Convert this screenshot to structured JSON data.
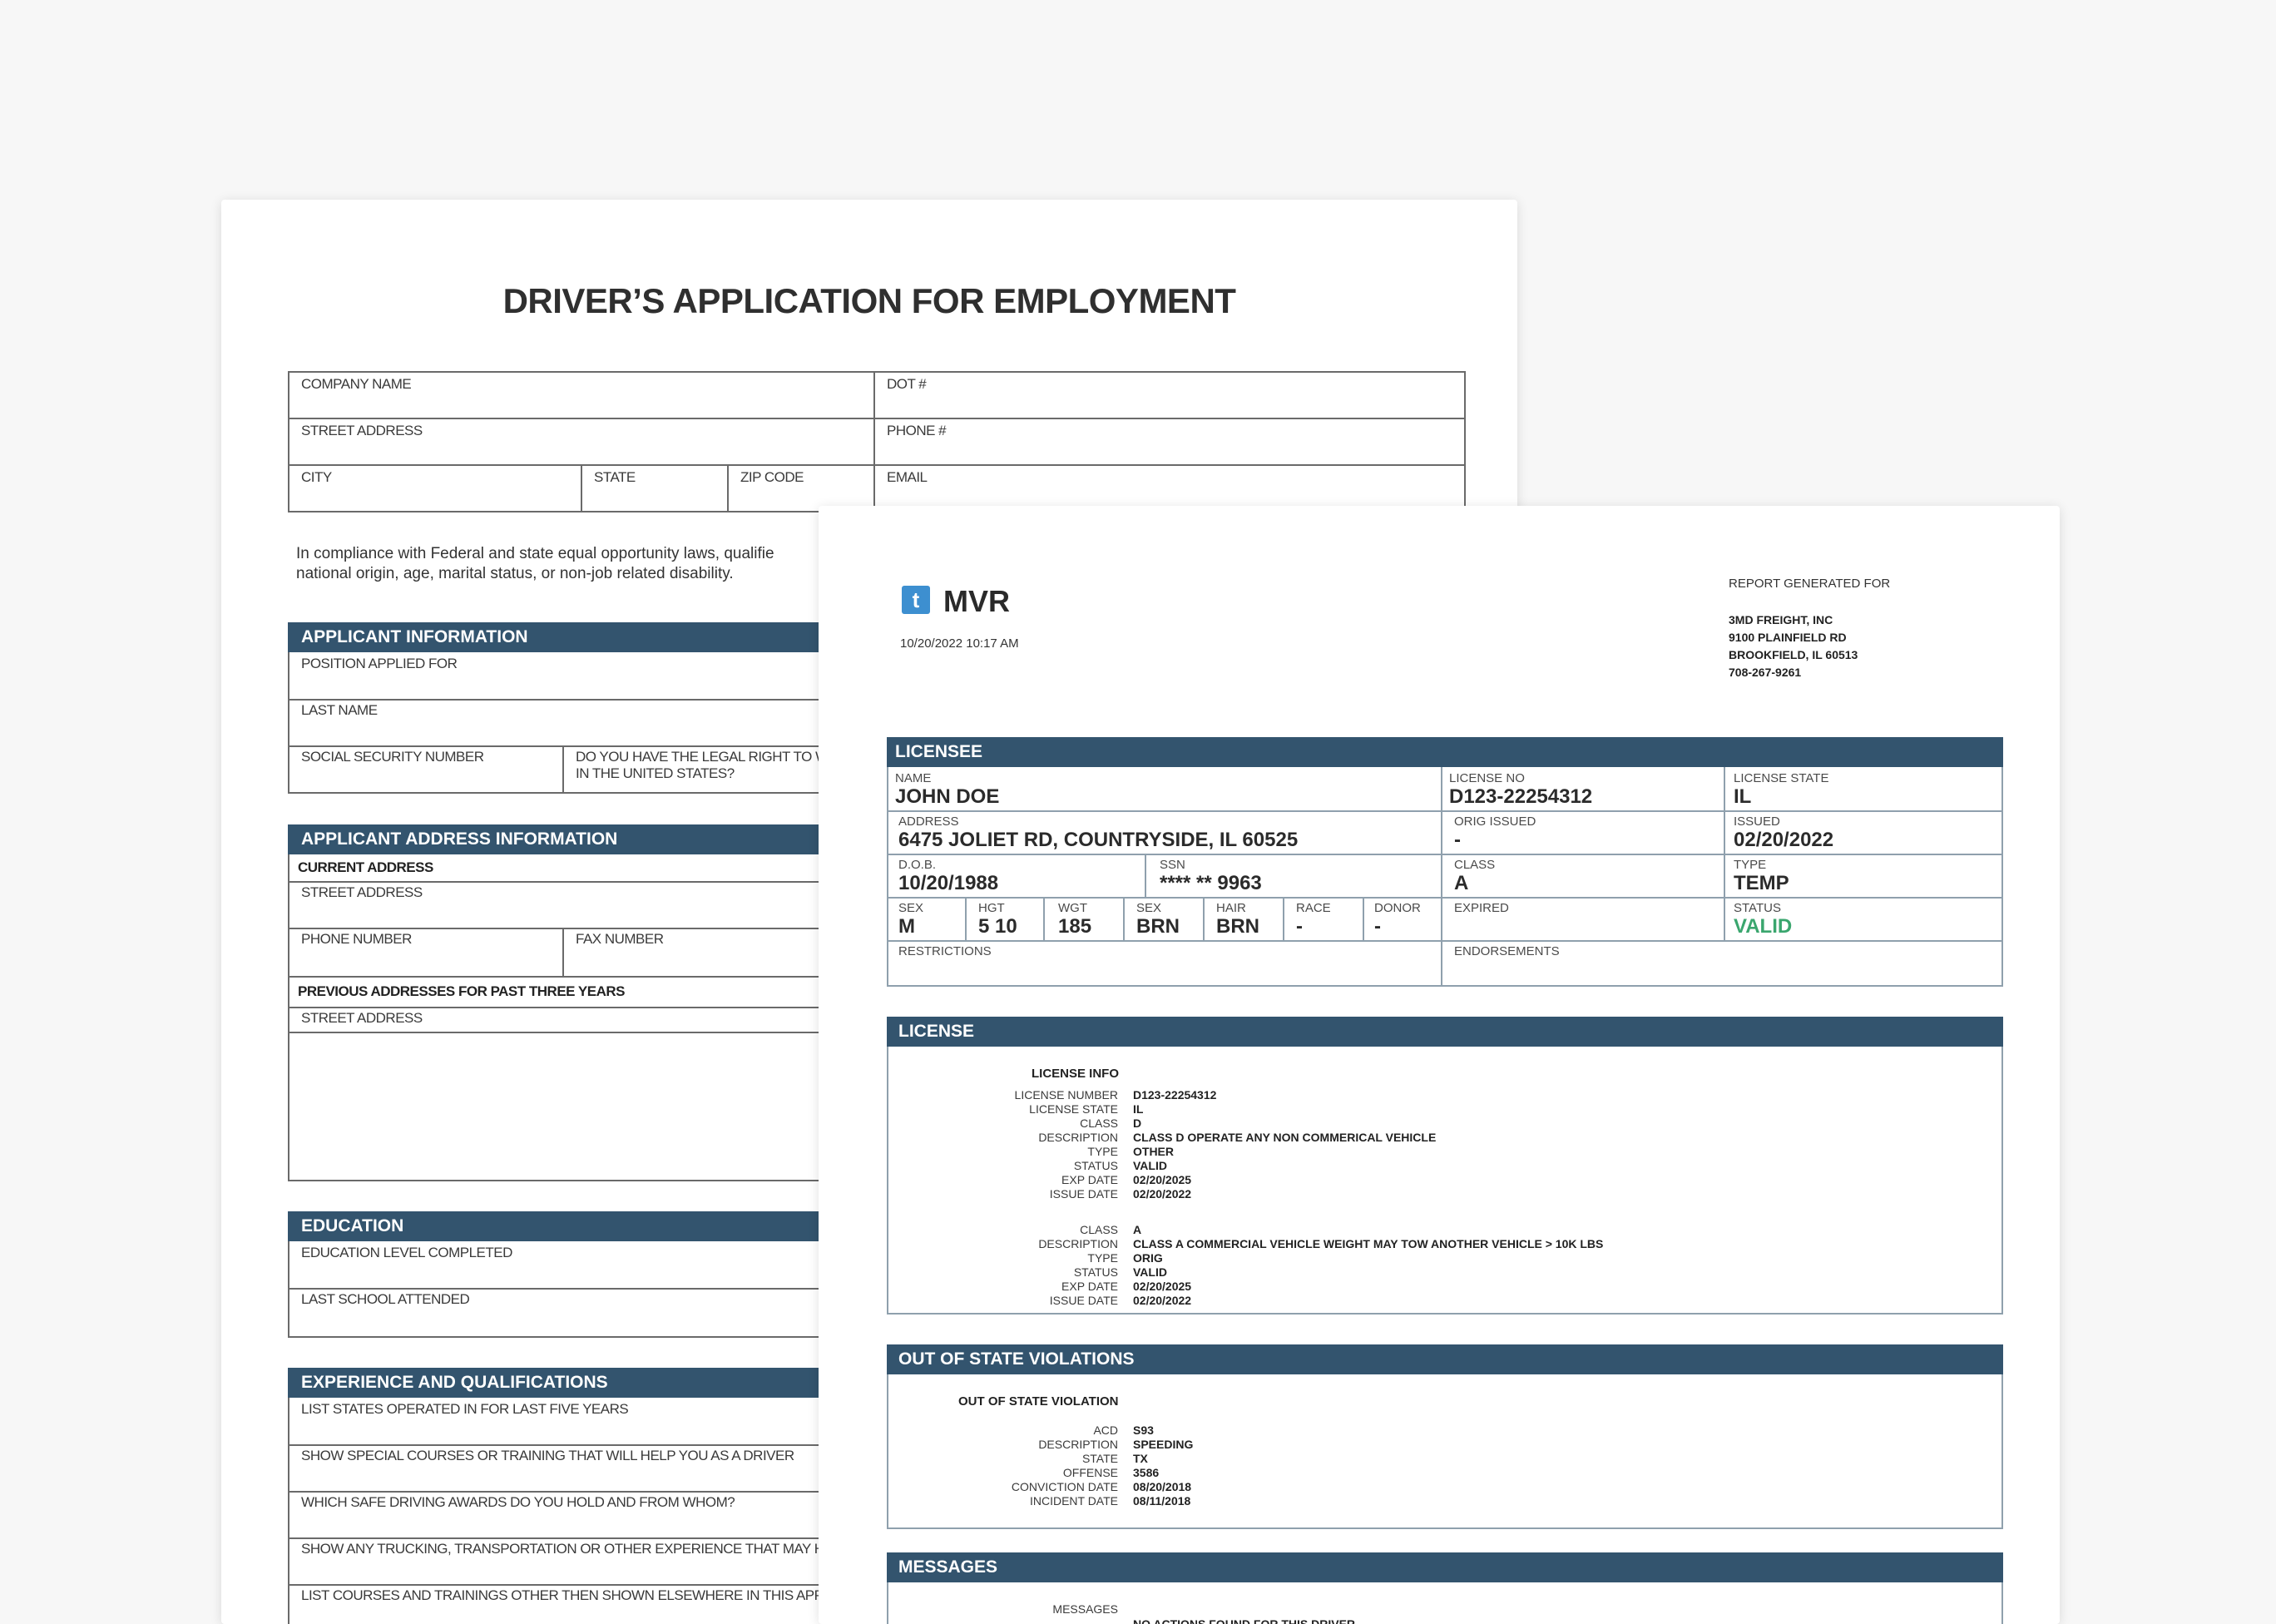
{
  "application": {
    "title": "DRIVER’S APPLICATION FOR EMPLOYMENT",
    "company": {
      "company_name": "COMPANY NAME",
      "dot": "DOT #",
      "street_address": "STREET ADDRESS",
      "phone": "PHONE #",
      "city": "CITY",
      "state": "STATE",
      "zip": "ZIP CODE",
      "email": "EMAIL"
    },
    "compliance": [
      "In compliance with Federal and state equal opportunity laws, qualifie",
      "national origin, age, marital status, or non-job related disability."
    ],
    "applicant_info": {
      "header": "APPLICANT INFORMATION",
      "position": "POSITION APPLIED FOR",
      "last_name": "LAST NAME",
      "ssn": "SOCIAL SECURITY NUMBER",
      "legal_right": [
        "DO YOU HAVE THE LEGAL RIGHT TO W",
        "IN THE UNITED STATES?"
      ]
    },
    "address_info": {
      "header": "APPLICANT ADDRESS INFORMATION",
      "current": "CURRENT ADDRESS",
      "street": "STREET ADDRESS",
      "phone": "PHONE NUMBER",
      "fax": "FAX NUMBER",
      "previous": "PREVIOUS ADDRESSES FOR PAST THREE YEARS",
      "prev_street": "STREET ADDRESS"
    },
    "education": {
      "header": "EDUCATION",
      "level": "EDUCATION LEVEL COMPLETED",
      "school": "LAST SCHOOL ATTENDED"
    },
    "experience": {
      "header": "EXPERIENCE AND QUALIFICATIONS",
      "rows": [
        "LIST STATES OPERATED IN FOR LAST FIVE YEARS",
        "SHOW SPECIAL COURSES OR TRAINING THAT WILL HELP YOU AS A DRIVER",
        "WHICH SAFE DRIVING AWARDS DO YOU HOLD AND FROM WHOM?",
        "SHOW ANY TRUCKING, TRANSPORTATION OR OTHER EXPERIENCE THAT MAY HE",
        "LIST COURSES AND TRAININGS OTHER THEN SHOWN ELSEWHERE IN THIS APPL"
      ]
    }
  },
  "mvr": {
    "logo_letter": "t",
    "title": "MVR",
    "timestamp": "10/20/2022 10:17 AM",
    "report_for_label": "REPORT GENERATED FOR",
    "company_lines": [
      "3MD FREIGHT, INC",
      "9100 PLAINFIELD RD",
      "BROOKFIELD, IL 60513",
      "708-267-9261"
    ],
    "accent_color": "#33546e",
    "valid_color": "#3aa66e",
    "licensee": {
      "header": "LICENSEE",
      "name_label": "NAME",
      "name": "JOHN DOE",
      "license_no_label": "LICENSE NO",
      "license_no": "D123-22254312",
      "license_state_label": "LICENSE STATE",
      "license_state": "IL",
      "address_label": "ADDRESS",
      "address": "6475 JOLIET RD, COUNTRYSIDE, IL 60525",
      "orig_issued_label": "ORIG ISSUED",
      "orig_issued": "-",
      "issued_label": "ISSUED",
      "issued": "02/20/2022",
      "dob_label": "D.O.B.",
      "dob": "10/20/1988",
      "ssn_label": "SSN",
      "ssn": "**** ** 9963",
      "class_label": "CLASS",
      "class": "A",
      "type_label": "TYPE",
      "type": "TEMP",
      "sex_label": "SEX",
      "sex": "M",
      "hgt_label": "HGT",
      "hgt": "5 10",
      "wgt_label": "WGT",
      "wgt": "185",
      "eye_label": "SEX",
      "eye": "BRN",
      "hair_label": "HAIR",
      "hair": "BRN",
      "race_label": "RACE",
      "race": "-",
      "donor_label": "DONOR",
      "donor": "-",
      "expired_label": "EXPIRED",
      "status_label": "STATUS",
      "status": "VALID",
      "restrictions_label": "RESTRICTIONS",
      "endorsements_label": "ENDORSEMENTS"
    },
    "license": {
      "header": "LICENSE",
      "subheader": "LICENSE INFO",
      "group1_keys": [
        "LICENSE NUMBER",
        "LICENSE STATE",
        "CLASS",
        "DESCRIPTION",
        "TYPE",
        "STATUS",
        "EXP DATE",
        "ISSUE DATE"
      ],
      "group1_vals": [
        "D123-22254312",
        "IL",
        "D",
        "CLASS D OPERATE ANY NON COMMERICAL VEHICLE",
        "OTHER",
        "VALID",
        "02/20/2025",
        "02/20/2022"
      ],
      "group2_keys": [
        "CLASS",
        "DESCRIPTION",
        "TYPE",
        "STATUS",
        "EXP DATE",
        "ISSUE DATE"
      ],
      "group2_vals": [
        "A",
        "CLASS A COMMERCIAL VEHICLE WEIGHT MAY TOW ANOTHER VEHICLE > 10K LBS",
        "ORIG",
        "VALID",
        "02/20/2025",
        "02/20/2022"
      ]
    },
    "violations": {
      "header": "OUT OF STATE VIOLATIONS",
      "subheader": "OUT OF STATE VIOLATION",
      "keys": [
        "ACD",
        "DESCRIPTION",
        "STATE",
        "OFFENSE",
        "CONVICTION DATE",
        "INCIDENT DATE"
      ],
      "vals": [
        "S93",
        "SPEEDING",
        "TX",
        "3586",
        "08/20/2018",
        "08/11/2018"
      ]
    },
    "messages": {
      "header": "MESSAGES",
      "label": "MESSAGES",
      "text": "NO ACTIONS FOUND FOR THIS DRIVER"
    }
  }
}
